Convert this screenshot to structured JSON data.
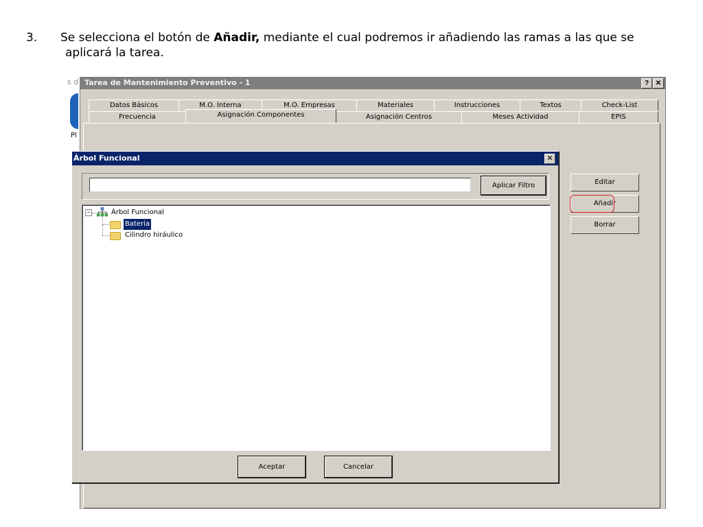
{
  "instruction": {
    "number": "3.",
    "text_before": "Se selecciona el botón de ",
    "bold": "Añadir,",
    "text_after": " mediante el cual podremos ir añadiendo las ramas a las que se",
    "line2": "aplicará la tarea."
  },
  "background": {
    "left_fragment": "s d",
    "pl_fragment": "Pl"
  },
  "main_window": {
    "title": "Tarea de Mantenimiento Preventivo - 1",
    "help_label": "?",
    "close_label": "✕",
    "tabs_row1": [
      "Datos Básicos",
      "M.O. Interna",
      "M.O. Empresas",
      "Materiales",
      "Instrucciones",
      "Textos",
      "Check-List"
    ],
    "tabs_row2": [
      "Frecuencia",
      "Asignación Componentes",
      "Asignación Centros",
      "Meses Actividad",
      "EPIS"
    ],
    "active_tab": "Asignación Componentes",
    "side_buttons": {
      "edit": "Editar",
      "add": "Añadir",
      "delete": "Borrar"
    }
  },
  "dialog": {
    "title": "Árbol Funcional",
    "close_label": "✕",
    "filter": {
      "value": "",
      "button": "Aplicar Filtro"
    },
    "tree": {
      "root": "Árbol Funcional",
      "root_expander": "−",
      "children": [
        {
          "label": "Bateria",
          "selected": true
        },
        {
          "label": "Cilindro hiráulico",
          "selected": false
        }
      ]
    },
    "ok_button": "Aceptar",
    "cancel_button": "Cancelar"
  },
  "colors": {
    "dialog_title_bg": "#0a246a",
    "main_title_bg": "#7e7e7e",
    "highlight": "#d02020",
    "window_bg": "#d4d0c8"
  }
}
